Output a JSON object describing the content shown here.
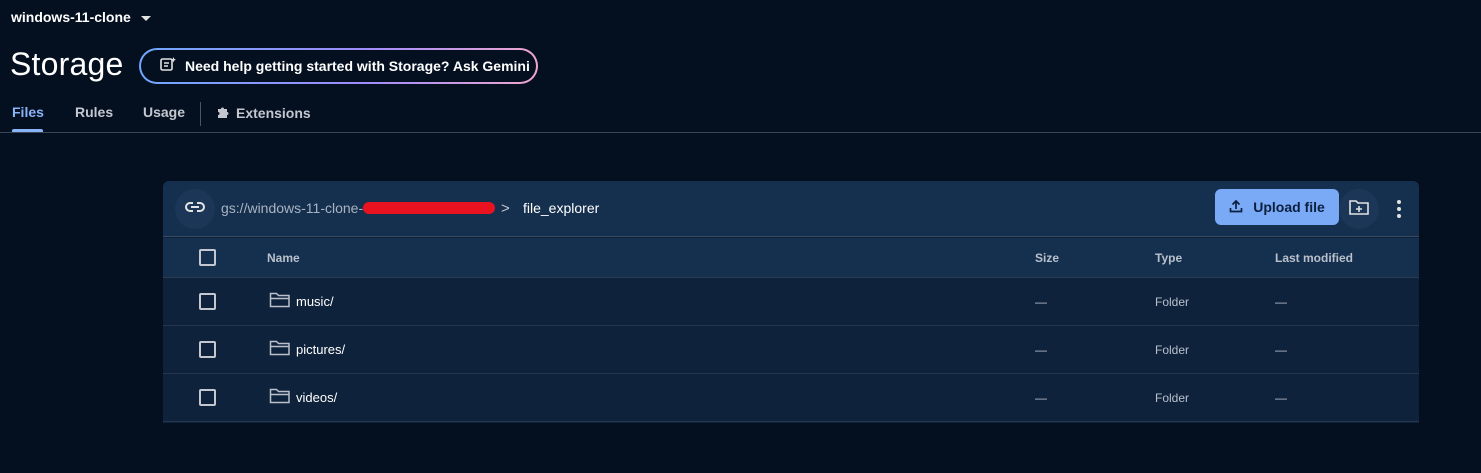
{
  "header": {
    "project_name": "windows-11-clone",
    "title": "Storage",
    "gemini_prompt": "Need help getting started with Storage? Ask Gemini"
  },
  "tabs": [
    {
      "label": "Files",
      "active": true
    },
    {
      "label": "Rules",
      "active": false
    },
    {
      "label": "Usage",
      "active": false
    },
    {
      "label": "Extensions",
      "active": false
    }
  ],
  "path_bar": {
    "bucket": "gs://windows-11-clone-",
    "separator": ">",
    "folder": "file_explorer",
    "upload_label": "Upload file"
  },
  "table": {
    "columns": [
      "Name",
      "Size",
      "Type",
      "Last modified"
    ],
    "rows": [
      {
        "name": "music/",
        "size": "—",
        "type": "Folder",
        "modified": "—"
      },
      {
        "name": "pictures/",
        "size": "—",
        "type": "Folder",
        "modified": "—"
      },
      {
        "name": "videos/",
        "size": "—",
        "type": "Folder",
        "modified": "—"
      }
    ]
  },
  "colors": {
    "background": "#041020",
    "accent": "#8ab4f8",
    "upload_button": "#7aaaf5",
    "redaction": "#e8131f"
  }
}
